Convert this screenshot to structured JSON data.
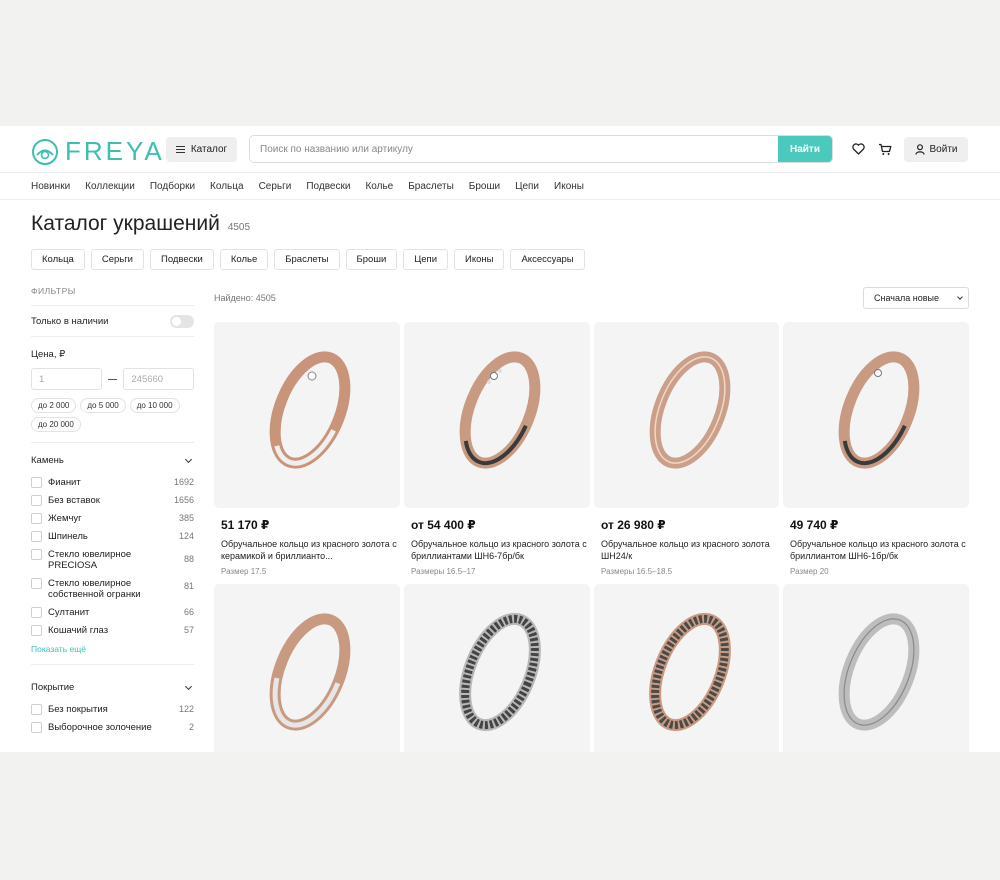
{
  "header": {
    "logo": "FREYA",
    "catalog_label": "Каталог",
    "search_placeholder": "Поиск по названию или артикулу",
    "search_button": "Найти",
    "login_label": "Войти",
    "accent": "#4cc9bd"
  },
  "nav": [
    "Новинки",
    "Коллекции",
    "Подборки",
    "Кольца",
    "Серьги",
    "Подвески",
    "Колье",
    "Браслеты",
    "Броши",
    "Цепи",
    "Иконы"
  ],
  "title": {
    "text": "Каталог украшений",
    "count": "4505"
  },
  "chips": [
    "Кольца",
    "Серьги",
    "Подвески",
    "Колье",
    "Браслеты",
    "Броши",
    "Цепи",
    "Иконы",
    "Аксессуары"
  ],
  "sidebar": {
    "filters_label": "ФИЛЬТРЫ",
    "in_stock_label": "Только в наличии",
    "price_label": "Цена, ₽",
    "price_from": "1",
    "price_to": "245660",
    "price_presets": [
      "до 2 000",
      "до 5 000",
      "до 10 000",
      "до 20 000"
    ],
    "stone": {
      "label": "Камень",
      "items": [
        {
          "label": "Фианит",
          "count": "1692"
        },
        {
          "label": "Без вставок",
          "count": "1656"
        },
        {
          "label": "Жемчуг",
          "count": "385"
        },
        {
          "label": "Шпинель",
          "count": "124"
        },
        {
          "label": "Стекло ювелирное PRECIOSA",
          "count": "88"
        },
        {
          "label": "Стекло ювелирное собственной огранки",
          "count": "81"
        },
        {
          "label": "Султанит",
          "count": "66"
        },
        {
          "label": "Кошачий глаз",
          "count": "57"
        }
      ],
      "show_more": "Показать ещё"
    },
    "coating": {
      "label": "Покрытие",
      "items": [
        {
          "label": "Без покрытия",
          "count": "122"
        },
        {
          "label": "Выборочное золочение",
          "count": "2"
        }
      ]
    }
  },
  "found": "Найдено: 4505",
  "sort": "Сначала новые",
  "products": [
    {
      "price": "51 170 ₽",
      "name": "Обручальное кольцо из красного золота с керамикой и бриллианто...",
      "size": "Размер 17.5"
    },
    {
      "price": "от 54 400 ₽",
      "name": "Обручальное кольцо из красного золота с бриллиантами ШН6-7бр/бк",
      "size": "Размеры 16.5–17"
    },
    {
      "price": "от 26 980 ₽",
      "name": "Обручальное кольцо из красного золота ШН24/к",
      "size": "Размеры 16.5–18.5"
    },
    {
      "price": "49 740 ₽",
      "name": "Обручальное кольцо из красного золота с бриллиантом ШН6-1бр/бк",
      "size": "Размер 20"
    }
  ]
}
